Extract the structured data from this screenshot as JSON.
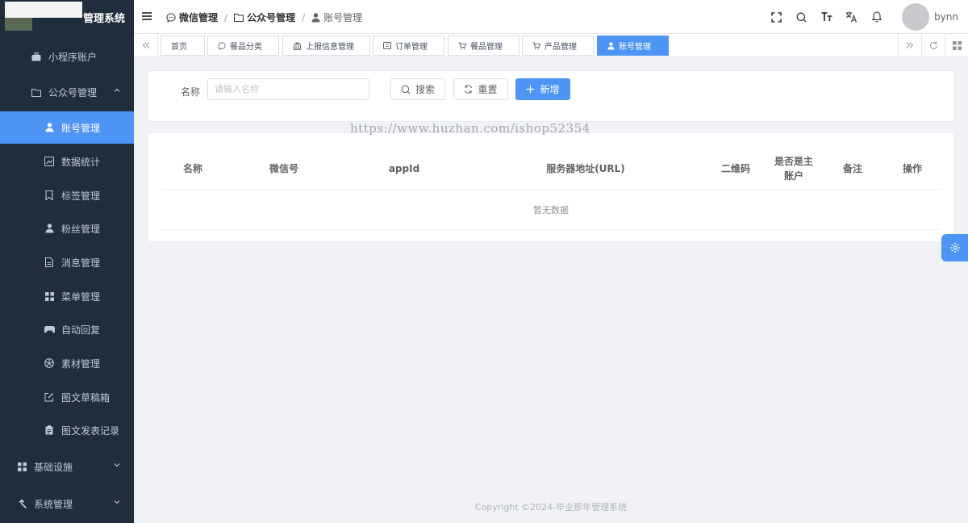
{
  "app": {
    "title": "管理系统"
  },
  "sidebar": {
    "items": [
      {
        "label": "小程序账户",
        "icon": "briefcase-icon"
      },
      {
        "label": "公众号管理",
        "icon": "folder-icon"
      },
      {
        "label": "账号管理",
        "icon": "user-icon"
      },
      {
        "label": "数据统计",
        "icon": "chart-icon"
      },
      {
        "label": "标签管理",
        "icon": "bookmark-icon"
      },
      {
        "label": "粉丝管理",
        "icon": "user-icon"
      },
      {
        "label": "消息管理",
        "icon": "document-icon"
      },
      {
        "label": "菜单管理",
        "icon": "grid-icon"
      },
      {
        "label": "自动回复",
        "icon": "gamepad-icon"
      },
      {
        "label": "素材管理",
        "icon": "aperture-icon"
      },
      {
        "label": "图文草稿箱",
        "icon": "edit-icon"
      },
      {
        "label": "图文发表记录",
        "icon": "clipboard-icon"
      },
      {
        "label": "基础设施",
        "icon": "grid-icon"
      },
      {
        "label": "系统管理",
        "icon": "hammer-icon"
      }
    ]
  },
  "breadcrumb": {
    "items": [
      "微信管理",
      "公众号管理",
      "账号管理"
    ]
  },
  "header": {
    "username": "bynn"
  },
  "tags": [
    "首页",
    "餐品分类",
    "上报信息管理",
    "订单管理",
    "餐品管理",
    "产品管理",
    "账号管理"
  ],
  "search": {
    "label": "名称",
    "placeholder": "请输入名称",
    "search_button": "搜索",
    "reset_button": "重置",
    "add_button": "新增"
  },
  "table": {
    "columns": [
      "名称",
      "微信号",
      "appId",
      "服务器地址(URL)",
      "二维码",
      "是否是主账户",
      "备注",
      "操作"
    ],
    "empty_text": "暂无数据"
  },
  "watermark": "https://www.huzhan.com/ishop52354",
  "footer": {
    "copyright": "Copyright ©2024-毕业那年管理系统"
  },
  "colors": {
    "primary": "#4d94f5",
    "sidebar_bg": "#1f2d3d"
  }
}
